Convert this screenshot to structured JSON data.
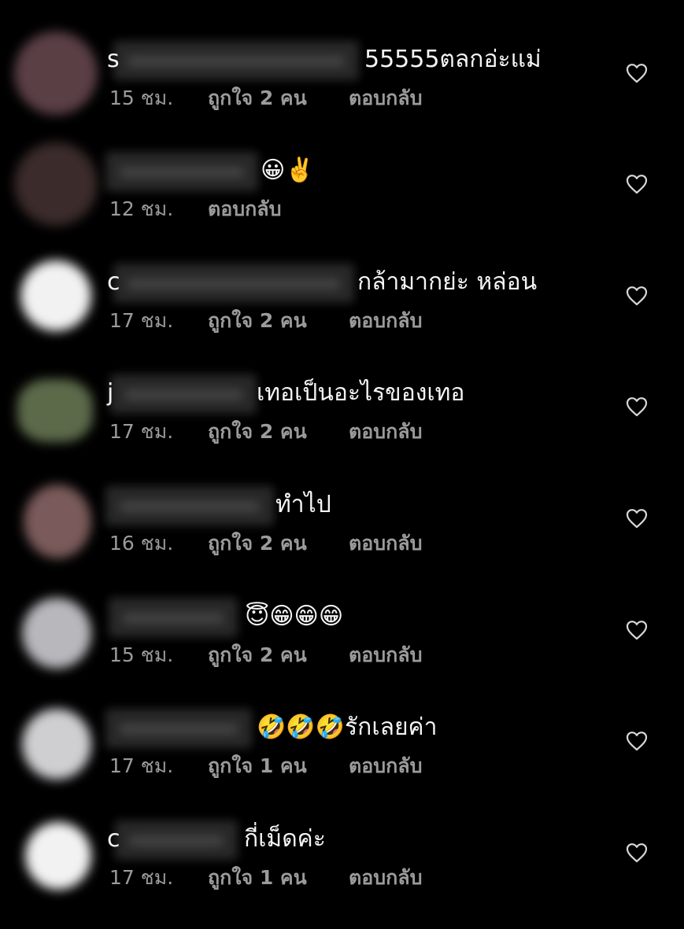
{
  "comments": [
    {
      "stray_initial": "s",
      "text": "55555ตลกอ่ะแม่",
      "time": "15 ชม.",
      "likes": "ถูกใจ 2 คน",
      "reply": "ตอบกลับ",
      "avatar_color": "#5a3f45"
    },
    {
      "stray_initial": "",
      "text": "😀✌️",
      "time": "12 ชม.",
      "likes": "",
      "reply": "ตอบกลับ",
      "avatar_color": "#3b2b2b"
    },
    {
      "stray_initial": "c",
      "text": "กล้ามากย่ะ หล่อน",
      "time": "17 ชม.",
      "likes": "ถูกใจ 2 คน",
      "reply": "ตอบกลับ",
      "avatar_color": "#f2f2f2"
    },
    {
      "stray_initial": "j",
      "text": "เทอเป็นอะไรของเทอ",
      "time": "17 ชม.",
      "likes": "ถูกใจ 2 คน",
      "reply": "ตอบกลับ",
      "avatar_color": "#5c6a4a"
    },
    {
      "stray_initial": "",
      "text": "ทำไป",
      "time": "16 ชม.",
      "likes": "ถูกใจ 2 คน",
      "reply": "ตอบกลับ",
      "avatar_color": "#7a5a5a"
    },
    {
      "stray_initial": "",
      "text": "😇😁😁😁",
      "time": "15 ชม.",
      "likes": "ถูกใจ 2 คน",
      "reply": "ตอบกลับ",
      "avatar_color": "#b8b8bc"
    },
    {
      "stray_initial": "",
      "text": "🤣🤣🤣รักเลยค่า",
      "time": "17 ชม.",
      "likes": "ถูกใจ 1 คน",
      "reply": "ตอบกลับ",
      "avatar_color": "#cfcfd2"
    },
    {
      "stray_initial": "c",
      "text": "กี่เม็ดค่ะ",
      "time": "17 ชม.",
      "likes": "ถูกใจ 1 คน",
      "reply": "ตอบกลับ",
      "avatar_color": "#f2f2f2"
    }
  ],
  "icons": {
    "like": "heart-outline-icon"
  }
}
